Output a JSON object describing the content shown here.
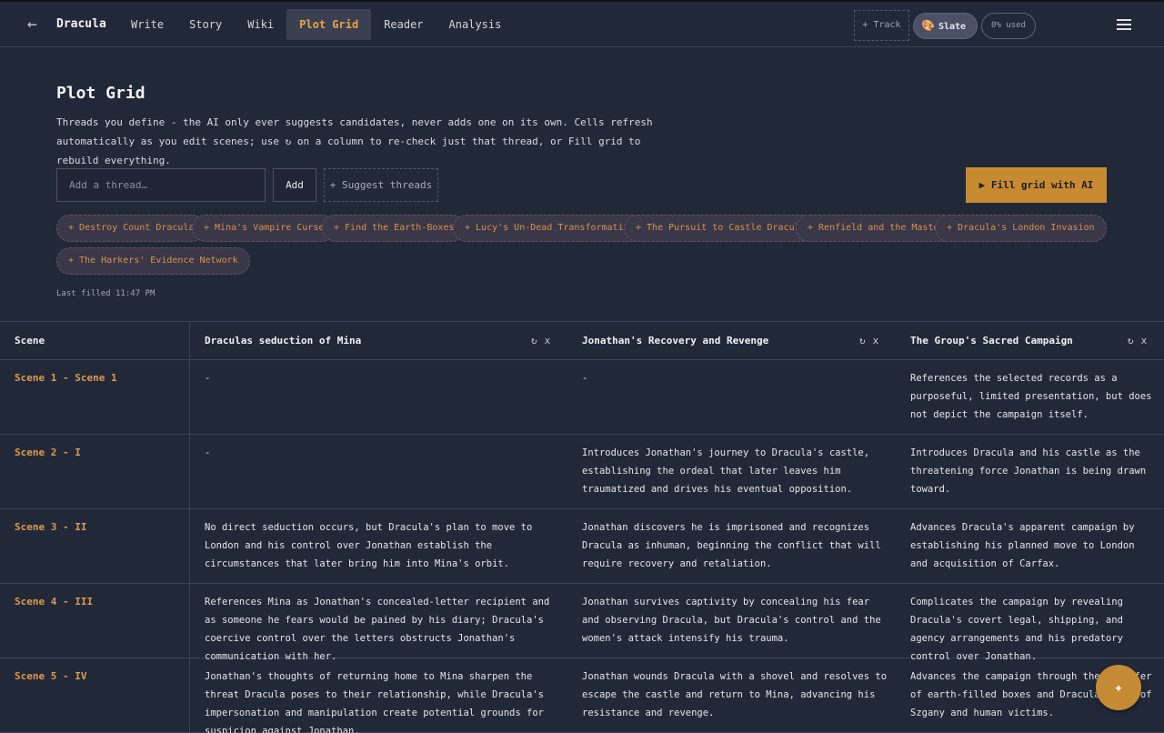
{
  "header": {
    "back_icon": "←",
    "title": "Dracula",
    "tabs": [
      "Write",
      "Story",
      "Wiki",
      "Plot Grid",
      "Reader",
      "Analysis"
    ],
    "active_tab": "Plot Grid",
    "track_label": "+ Track",
    "theme_label": "Slate",
    "theme_icon": "🎨",
    "usage_label": "0% used"
  },
  "page": {
    "title": "Plot Grid",
    "description": "Threads you define - the AI only ever suggests candidates, never adds one on its own. Cells refresh automatically as you edit scenes; use ↻ on a column to re-check just that thread, or Fill grid to rebuild everything.",
    "input_placeholder": "Add a thread…",
    "add_label": "Add",
    "suggest_label": "+ Suggest threads",
    "fill_label": "▶ Fill grid with AI",
    "last_filled": "Last filled 11:47 PM"
  },
  "suggested_threads": [
    "+ Destroy Count Dracula",
    "+ Mina's Vampire Curse",
    "+ Find the Earth-Boxes",
    "+ Lucy's Un-Dead Transformation",
    "+ The Pursuit to Castle Dracula",
    "+ Renfield and the Master",
    "+ Dracula's London Invasion",
    "+ The Harkers' Evidence Network"
  ],
  "grid": {
    "scene_header": "Scene",
    "refresh_icon": "↻",
    "remove_icon": "x",
    "columns": [
      "Draculas seduction of Mina",
      "Jonathan's Recovery and Revenge",
      "The Group's Sacred Campaign"
    ],
    "rows": [
      {
        "scene": "Scene 1 - Scene 1",
        "cells": [
          "-",
          "-",
          "References the selected records as a purposeful, limited presentation, but does not depict the campaign itself."
        ]
      },
      {
        "scene": "Scene 2 - I",
        "cells": [
          "-",
          "Introduces Jonathan's journey to Dracula's castle, establishing the ordeal that later leaves him traumatized and drives his eventual opposition.",
          "Introduces Dracula and his castle as the threatening force Jonathan is being drawn toward."
        ]
      },
      {
        "scene": "Scene 3 - II",
        "cells": [
          "No direct seduction occurs, but Dracula's plan to move to London and his control over Jonathan establish the circumstances that later bring him into Mina's orbit.",
          "Jonathan discovers he is imprisoned and recognizes Dracula as inhuman, beginning the conflict that will require recovery and retaliation.",
          "Advances Dracula's apparent campaign by establishing his planned move to London and acquisition of Carfax."
        ]
      },
      {
        "scene": "Scene 4 - III",
        "cells": [
          "References Mina as Jonathan's concealed-letter recipient and as someone he fears would be pained by his diary; Dracula's coercive control over the letters obstructs Jonathan's communication with her.",
          "Jonathan survives captivity by concealing his fear and observing Dracula, but Dracula's control and the women's attack intensify his trauma.",
          "Complicates the campaign by revealing Dracula's covert legal, shipping, and agency arrangements and his predatory control over Jonathan."
        ]
      },
      {
        "scene": "Scene 5 - IV",
        "cells": [
          "Jonathan's thoughts of returning home to Mina sharpen the threat Dracula poses to their relationship, while Dracula's impersonation and manipulation create potential grounds for suspicion against Jonathan.",
          "Jonathan wounds Dracula with a shovel and resolves to escape the castle and return to Mina, advancing his resistance and revenge.",
          "Advances the campaign through the transfer of earth-filled boxes and Dracula's use of Szgany and human victims."
        ]
      }
    ]
  },
  "fab_icon": "✦"
}
